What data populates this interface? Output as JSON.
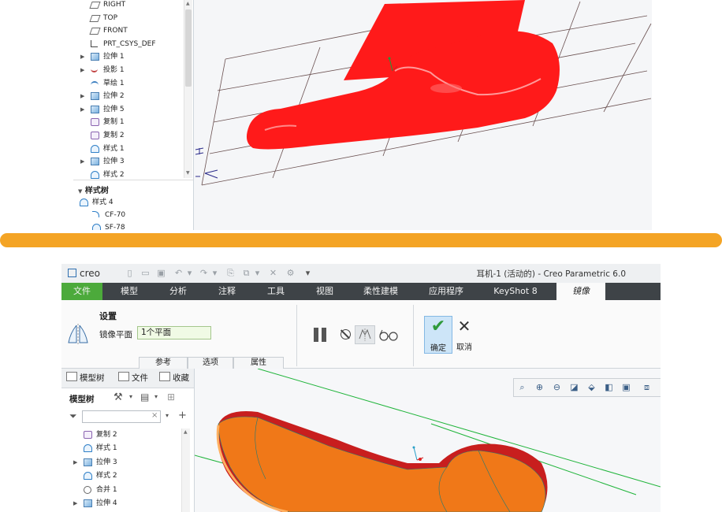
{
  "top_screenshot": {
    "tree_items": [
      {
        "label": "RIGHT",
        "icon": "plane-icon",
        "expand": false
      },
      {
        "label": "TOP",
        "icon": "plane-icon",
        "expand": false
      },
      {
        "label": "FRONT",
        "icon": "plane-icon",
        "expand": false
      },
      {
        "label": "PRT_CSYS_DEF",
        "icon": "csys-icon",
        "expand": false
      },
      {
        "label": "拉伸 1",
        "icon": "extrude-icon",
        "expand": true
      },
      {
        "label": "投影 1",
        "icon": "projection-icon",
        "expand": true
      },
      {
        "label": "草绘 1",
        "icon": "sketch-icon",
        "expand": false
      },
      {
        "label": "拉伸 2",
        "icon": "extrude-icon",
        "expand": true
      },
      {
        "label": "拉伸 5",
        "icon": "extrude-icon",
        "expand": true
      },
      {
        "label": "复制 1",
        "icon": "copy-icon",
        "expand": false
      },
      {
        "label": "复制 2",
        "icon": "copy-icon",
        "expand": false
      },
      {
        "label": "样式 1",
        "icon": "style-icon",
        "expand": false
      },
      {
        "label": "拉伸 3",
        "icon": "extrude-icon",
        "expand": true
      },
      {
        "label": "样式 2",
        "icon": "style-icon",
        "expand": false
      }
    ],
    "style_tree_heading": "样式树",
    "style_tree_items": [
      {
        "label": "样式 4",
        "icon": "style-icon"
      },
      {
        "label": "CF-70",
        "icon": "curve-icon"
      },
      {
        "label": "SF-78",
        "icon": "surface-icon"
      }
    ]
  },
  "bottom_screenshot": {
    "app_logo": "creo",
    "window_title": "耳机-1 (活动的) - Creo Parametric 6.0",
    "ribbon_tabs": [
      "文件",
      "模型",
      "分析",
      "注释",
      "工具",
      "视图",
      "柔性建模",
      "应用程序",
      "KeyShot 8",
      "镜像"
    ],
    "active_tab": "镜像",
    "settings_label": "设置",
    "mirror_plane_label": "镜像平面",
    "mirror_plane_value": "1个平面",
    "sub_tabs": [
      "参考",
      "选项",
      "属性"
    ],
    "ok_label": "确定",
    "cancel_label": "取消",
    "tree_panel_tabs": [
      "模型树",
      "文件",
      "收藏"
    ],
    "tree_toolbar_label": "模型树",
    "search_placeholder": "",
    "tree_items": [
      {
        "label": "复制 2",
        "icon": "copy-icon",
        "expand": false
      },
      {
        "label": "样式 1",
        "icon": "style-icon",
        "expand": false
      },
      {
        "label": "拉伸 3",
        "icon": "extrude-icon",
        "expand": true
      },
      {
        "label": "样式 2",
        "icon": "style-icon",
        "expand": false
      },
      {
        "label": "合并 1",
        "icon": "merge-icon",
        "expand": false
      },
      {
        "label": "拉伸 4",
        "icon": "extrude-icon",
        "expand": true
      }
    ]
  },
  "colors": {
    "divider": "#f4a425",
    "model_red": "#ff1a1a",
    "model_orange": "#f07818",
    "file_tab": "#4caa3b",
    "ribbon_dark": "#3e4347"
  }
}
